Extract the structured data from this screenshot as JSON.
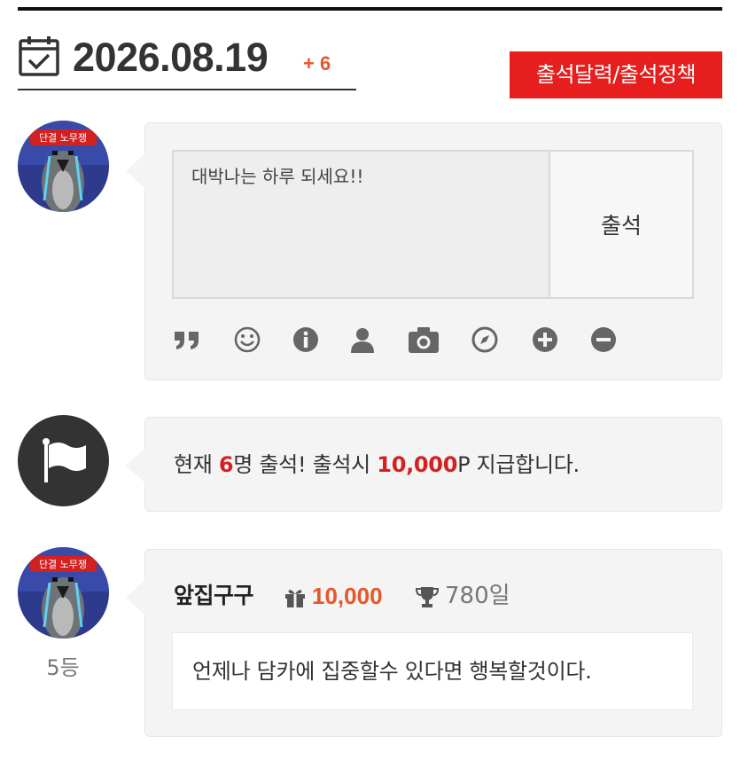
{
  "header": {
    "date": "2026.08.19",
    "delta": "+ 6",
    "policy_button": "출석달력/출석정책"
  },
  "checkin_form": {
    "message": "대박나는 하루 되세요!!",
    "submit_label": "출석",
    "tools": [
      "quote-icon",
      "smile-icon",
      "info-icon",
      "user-icon",
      "camera-icon",
      "compass-icon",
      "plus-circle-icon",
      "minus-circle-icon"
    ]
  },
  "status": {
    "prefix": "현재 ",
    "count": "6",
    "middle": "명 출석! 출석시 ",
    "points": "10,000",
    "suffix": "P 지급합니다."
  },
  "entry": {
    "nickname": "앞집구구",
    "points": "10,000",
    "days": "780일",
    "rank": "5등",
    "comment": "언제나 담카에 집중할수 있다면 행복할것이다.",
    "avatar_banner": "단결 노무쟁"
  },
  "colors": {
    "accent_red": "#e61e1e",
    "highlight_red": "#d32121",
    "orange": "#e8562a",
    "icon_gray": "#666666"
  }
}
